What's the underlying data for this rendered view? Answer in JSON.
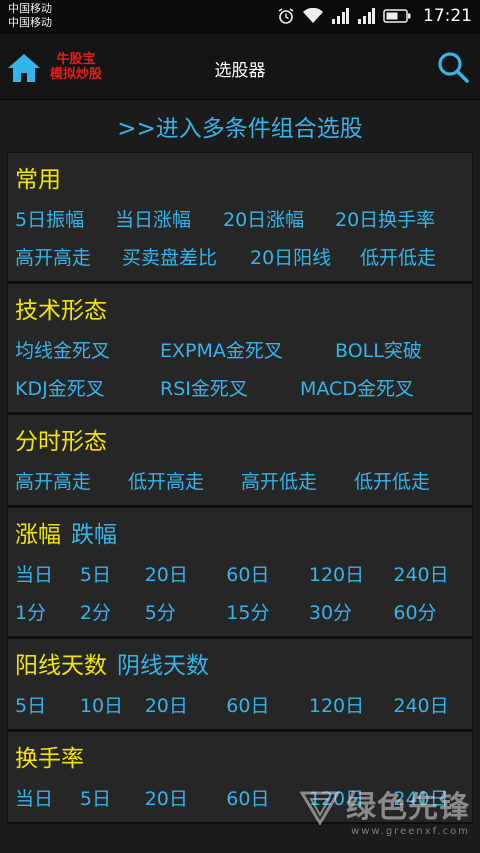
{
  "status": {
    "carrier1": "中国移动",
    "carrier2": "中国移动",
    "time": "17:21"
  },
  "appbar": {
    "logo_line1": "牛股宝",
    "logo_line2": "模拟炒股",
    "title": "选股器"
  },
  "combo_link": ">>进入多条件组合选股",
  "sections": [
    {
      "title": "常用",
      "rows": [
        [
          "5日振幅",
          "当日涨幅",
          "20日涨幅",
          "20日换手率"
        ],
        [
          "高开高走",
          "买卖盘差比",
          "20日阳线",
          "低开低走"
        ]
      ]
    },
    {
      "title": "技术形态",
      "rows": [
        [
          "均线金死叉",
          "EXPMA金死叉",
          "BOLL突破"
        ],
        [
          "KDJ金死叉",
          "RSI金死叉",
          "MACD金死叉"
        ]
      ]
    },
    {
      "title": "分时形态",
      "rows": [
        [
          "高开高走",
          "低开高走",
          "高开低走",
          "低开低走"
        ]
      ]
    },
    {
      "title": "涨幅",
      "title_alt": "跌幅",
      "rows": [
        [
          "当日",
          "5日",
          "20日",
          "60日",
          "120日",
          "240日"
        ],
        [
          "1分",
          "2分",
          "5分",
          "15分",
          "30分",
          "60分"
        ]
      ]
    },
    {
      "title": "阳线天数",
      "title_alt": "阴线天数",
      "rows": [
        [
          "5日",
          "10日",
          "20日",
          "60日",
          "120日",
          "240日"
        ]
      ]
    },
    {
      "title": "换手率",
      "rows": [
        [
          "当日",
          "5日",
          "20日",
          "60日",
          "120日",
          "240日"
        ]
      ]
    }
  ],
  "watermark": {
    "text": "绿色先锋",
    "url": "www.greenxf.com"
  }
}
